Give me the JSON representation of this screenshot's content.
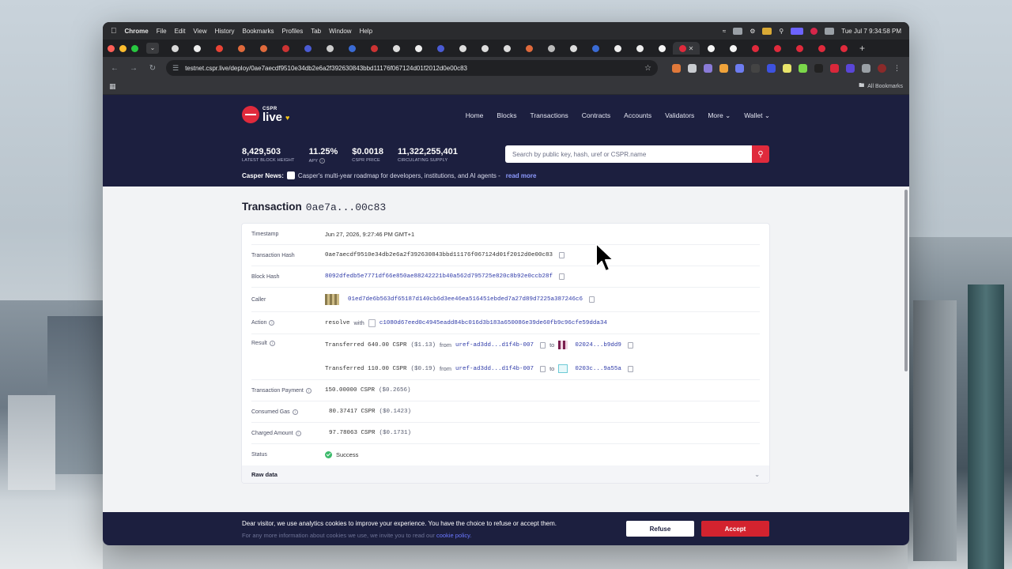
{
  "os": {
    "app_name": "Chrome",
    "menu": [
      "File",
      "Edit",
      "View",
      "History",
      "Bookmarks",
      "Profiles",
      "Tab",
      "Window",
      "Help"
    ],
    "clock": "Tue Jul 7  9:34:58 PM"
  },
  "browser": {
    "url": "testnet.cspr.live/deploy/0ae7aecdf9510e34db2e6a2f392630843bbd11176f067124d01f2012d0e00c83",
    "all_bookmarks": "All Bookmarks",
    "colors": {
      "close": "#ff5f57",
      "minimize": "#febc2e",
      "zoom": "#28c840"
    }
  },
  "site": {
    "logo_small": "CSPR",
    "logo_big": "live",
    "nav": [
      "Home",
      "Blocks",
      "Transactions",
      "Contracts",
      "Accounts",
      "Validators",
      "More",
      "Wallet"
    ],
    "stats": [
      {
        "value": "8,429,503",
        "label": "LATEST BLOCK HEIGHT"
      },
      {
        "value": "11.25%",
        "label": "APY"
      },
      {
        "value": "$0.0018",
        "label": "CSPR PRICE"
      },
      {
        "value": "11,322,255,401",
        "label": "CIRCULATING SUPPLY"
      }
    ],
    "search_placeholder": "Search by public key, hash, uref or CSPR.name",
    "news_label": "Casper News:",
    "news_text": "Casper's multi-year roadmap for developers, institutions, and AI agents -",
    "news_link": "read more",
    "brand_color": "#e02a3c",
    "header_color": "#1c1f3f"
  },
  "transaction": {
    "title": "Transaction",
    "short_hash": "0ae7a...00c83",
    "labels": {
      "timestamp": "Timestamp",
      "hash": "Transaction Hash",
      "block_hash": "Block Hash",
      "caller": "Caller",
      "action": "Action",
      "result": "Result",
      "payment": "Transaction Payment",
      "gas": "Consumed Gas",
      "charged": "Charged Amount",
      "status": "Status",
      "raw": "Raw data"
    },
    "timestamp": "Jun 27, 2026, 9:27:46 PM GMT+1",
    "hash": "0ae7aecdf9510e34db2e6a2f392630843bbd11176f067124d01f2012d0e00c83",
    "block_hash": "8092dfedb5e7771df66e850ae88242221b40a562d795725e820c8b92e0ccb28f",
    "caller": "01ed7de6b563df65187d140cb6d3ee46ea516451ebded7a27d89d7225a387246c6",
    "action_verb": "resolve",
    "action_with": "with",
    "action_contract": "c1080d67eed0c4945eadd84bc016d3b183a650086e39de60fb9c96cfe59dda34",
    "transfers": [
      {
        "text": "Transferred 640.00 CSPR",
        "usd": "($1.13)",
        "from_label": "from",
        "from": "uref-ad3dd...d1f4b-007",
        "to_label": "to",
        "to": "02024...b9dd9"
      },
      {
        "text": "Transferred 110.00 CSPR",
        "usd": "($0.19)",
        "from_label": "from",
        "from": "uref-ad3dd...d1f4b-007",
        "to_label": "to",
        "to": "0203c...9a55a"
      }
    ],
    "payment": "150.00000 CSPR",
    "payment_usd": "($0.2656)",
    "gas": "80.37417 CSPR",
    "gas_usd": "($0.1423)",
    "charged": "97.78063 CSPR",
    "charged_usd": "($0.1731)",
    "status": "Success"
  },
  "cookie": {
    "line1": "Dear visitor, we use analytics cookies to improve your experience. You have the choice to refuse or accept them.",
    "line2": "For any more information about cookies we use, we invite you to read our",
    "link": "cookie policy.",
    "refuse": "Refuse",
    "accept": "Accept"
  }
}
